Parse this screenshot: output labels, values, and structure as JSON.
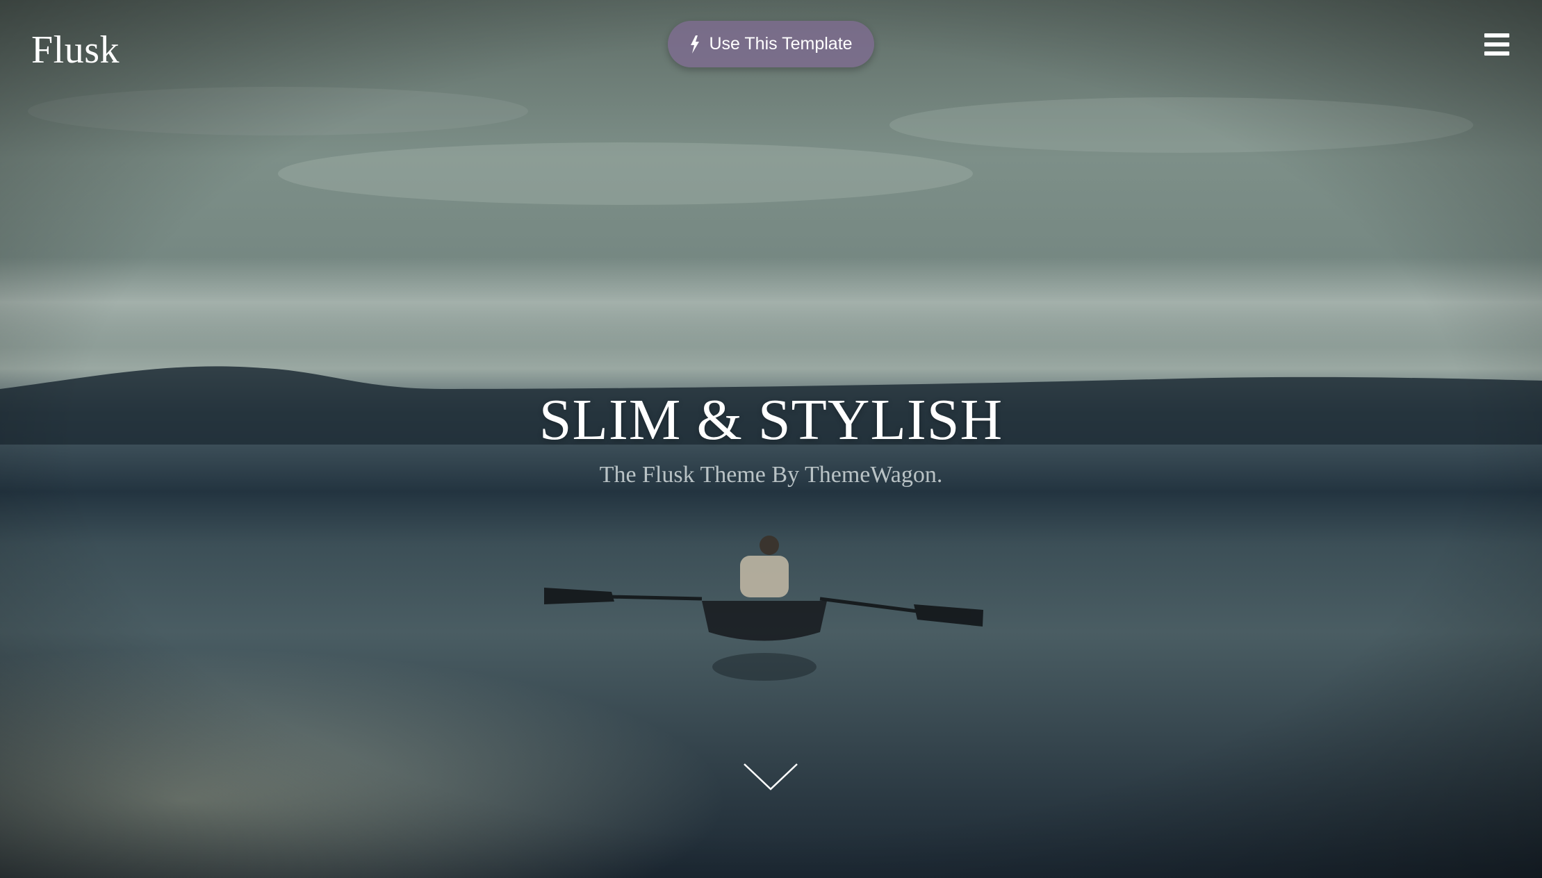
{
  "header": {
    "logo_text": "Flusk",
    "cta_label": "Use This Template",
    "cta_icon": "lightning-bolt-icon",
    "menu_icon": "hamburger-menu-icon"
  },
  "hero": {
    "title": "SLIM & STYLISH",
    "subtitle": "The Flusk Theme By ThemeWagon.",
    "scroll_icon": "chevron-down-icon"
  },
  "colors": {
    "cta_background": "#7c6c8e",
    "text": "#ffffff",
    "sky": "#7f9089",
    "water": "#263440"
  }
}
